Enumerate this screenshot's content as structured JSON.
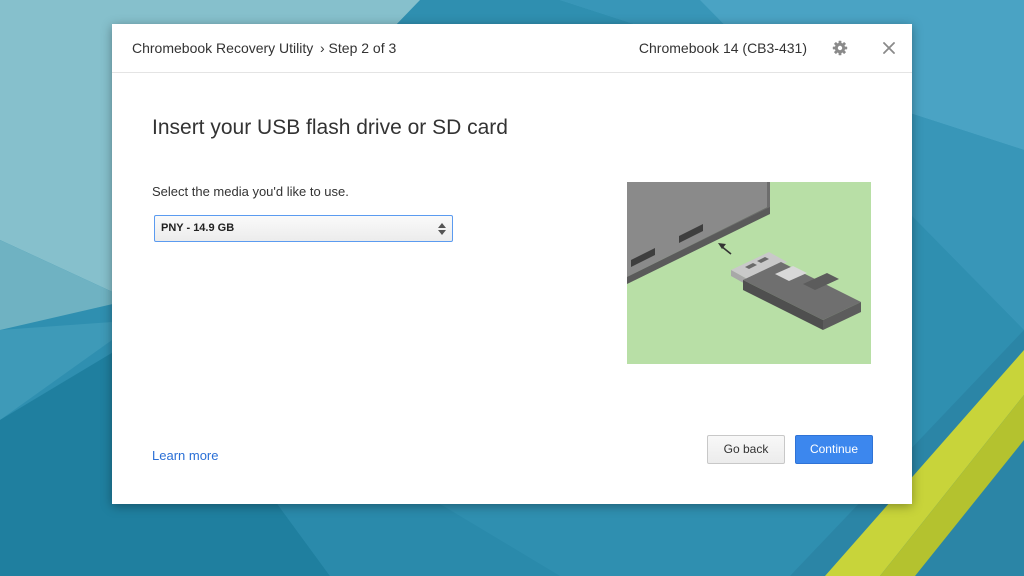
{
  "header": {
    "app_title": "Chromebook Recovery Utility",
    "step": "› Step 2 of 3",
    "device": "Chromebook 14 (CB3-431)",
    "settings_icon": "gear-icon",
    "close_icon": "close-icon"
  },
  "main": {
    "heading": "Insert your USB flash drive or SD card",
    "prompt": "Select the media you'd like to use.",
    "media_select": {
      "selected": "PNY - 14.9 GB"
    },
    "illustration": "usb-drive-insert-illustration"
  },
  "footer": {
    "learn_more": "Learn more",
    "back_label": "Go back",
    "continue_label": "Continue"
  },
  "colors": {
    "accent": "#3c87ee",
    "link": "#2a6fd6",
    "illustration_bg": "#b8dfa6"
  }
}
